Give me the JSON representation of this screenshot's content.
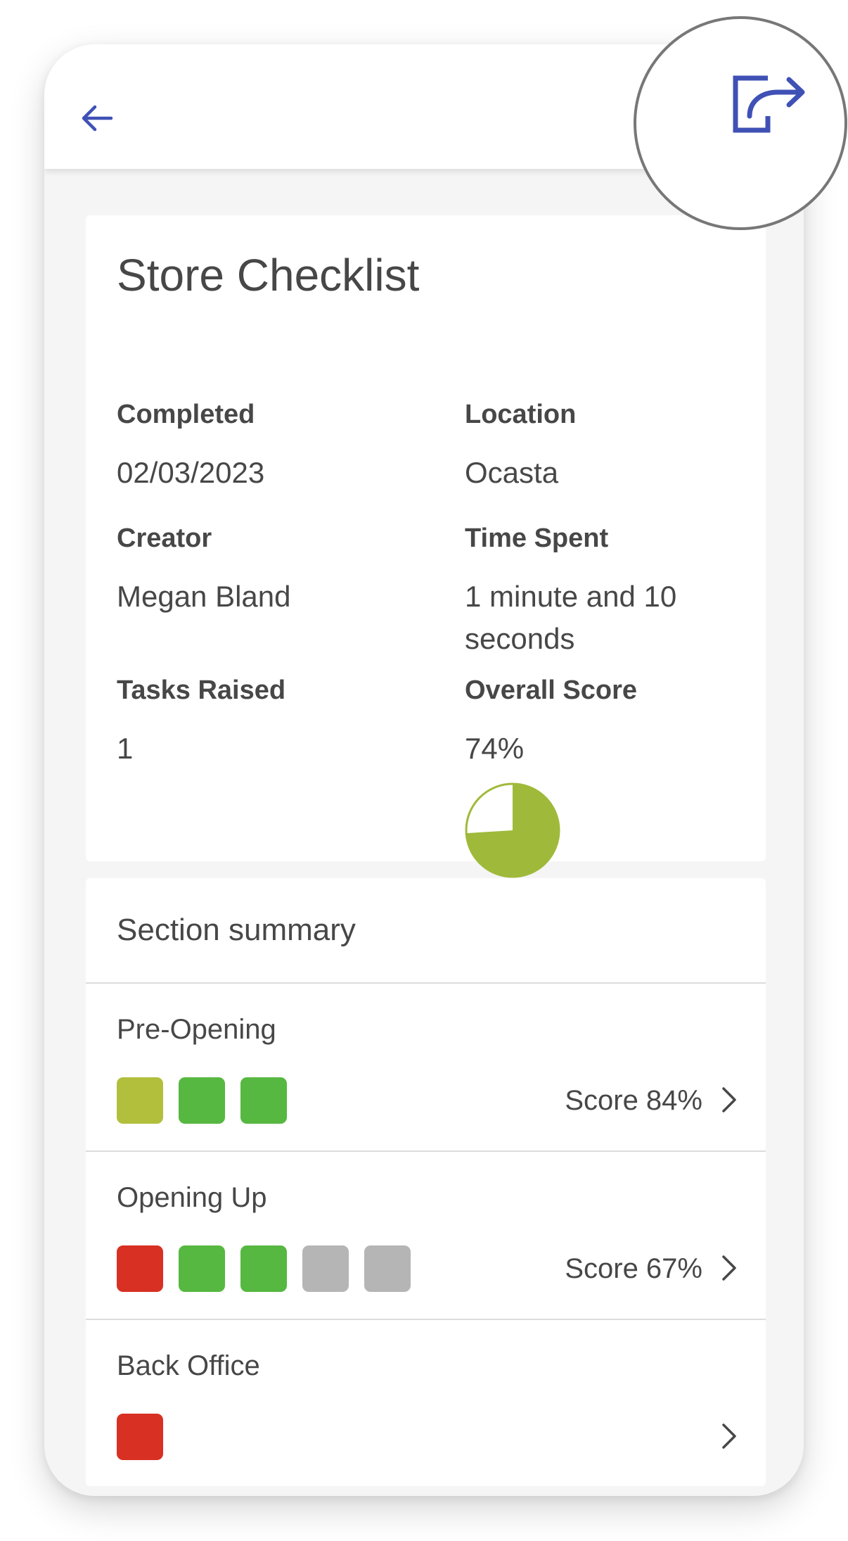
{
  "header": {
    "back_icon": "arrow-left-icon",
    "export_icon": "export-share-icon",
    "accent_color": "#3f51b5"
  },
  "checklist": {
    "title": "Store Checklist",
    "fields": {
      "completed": {
        "label": "Completed",
        "value": "02/03/2023"
      },
      "location": {
        "label": "Location",
        "value": "Ocasta"
      },
      "creator": {
        "label": "Creator",
        "value": "Megan Bland"
      },
      "time_spent": {
        "label": "Time Spent",
        "value": "1 minute and 10 seconds"
      },
      "tasks_raised": {
        "label": "Tasks Raised",
        "value": "1"
      },
      "overall_score": {
        "label": "Overall Score",
        "value": "74%",
        "fraction": 0.74,
        "color": "#9fba3a"
      }
    }
  },
  "section_summary": {
    "title": "Section summary",
    "sections": [
      {
        "name": "Pre-Opening",
        "score_label": "Score 84%",
        "squares": [
          "#b2bf3d",
          "#56b840",
          "#56b840"
        ]
      },
      {
        "name": "Opening Up",
        "score_label": "Score 67%",
        "squares": [
          "#d83023",
          "#56b840",
          "#56b840",
          "#b5b5b5",
          "#b5b5b5"
        ]
      },
      {
        "name": "Back Office",
        "score_label": "",
        "squares": [
          "#d83023"
        ]
      }
    ]
  }
}
